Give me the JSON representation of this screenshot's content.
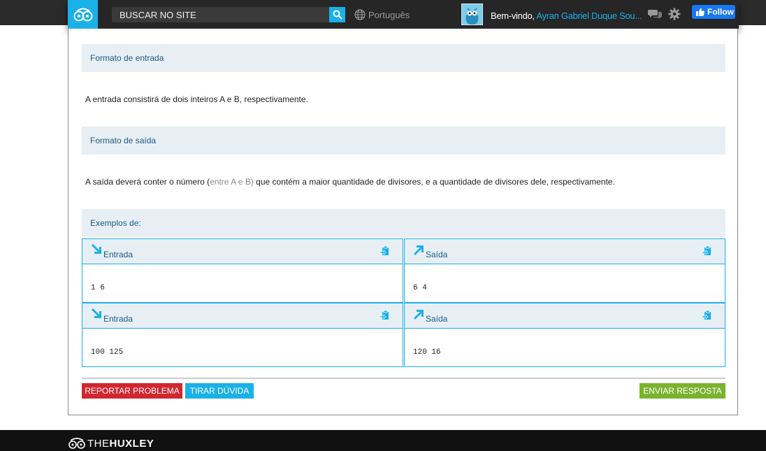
{
  "header": {
    "search_placeholder": "BUSCAR NO SITE",
    "language": "Português",
    "welcome_prefix": "Bem-vindo, ",
    "user_name": "Ayran Gabriel Duque Sou...",
    "facebook_follow": "Follow"
  },
  "problem": {
    "input_format_title": "Formato de entrada",
    "input_format_text": "A entrada consistirá de dois inteiros A e B, respectivamente.",
    "output_format_title": "Formato de saída",
    "output_text_before": "A saída deverá conter o número (",
    "output_text_muted": "entre A e B)",
    "output_text_after": " que contém a maior quantidade de divisores, e a quantidade de divisores dele, respectivamente.",
    "examples_title": "Exemplos de:"
  },
  "examples": [
    {
      "input_label": "Entrada",
      "input_value": "1 6",
      "output_label": "Saída",
      "output_value": "6 4"
    },
    {
      "input_label": "Entrada",
      "input_value": "100 125",
      "output_label": "Saída",
      "output_value": "120 16"
    }
  ],
  "actions": {
    "report": "REPORTAR PROBLEMA",
    "question": "TIRAR DÚVIDA",
    "submit": "ENVIAR RESPOSTA"
  },
  "footer": {
    "brand_light": "THE",
    "brand_bold": "HUXLEY"
  },
  "colors": {
    "accent": "#1ab0e8",
    "report": "#d22630",
    "submit": "#7ab32e",
    "section_bg": "#e7eff5"
  }
}
